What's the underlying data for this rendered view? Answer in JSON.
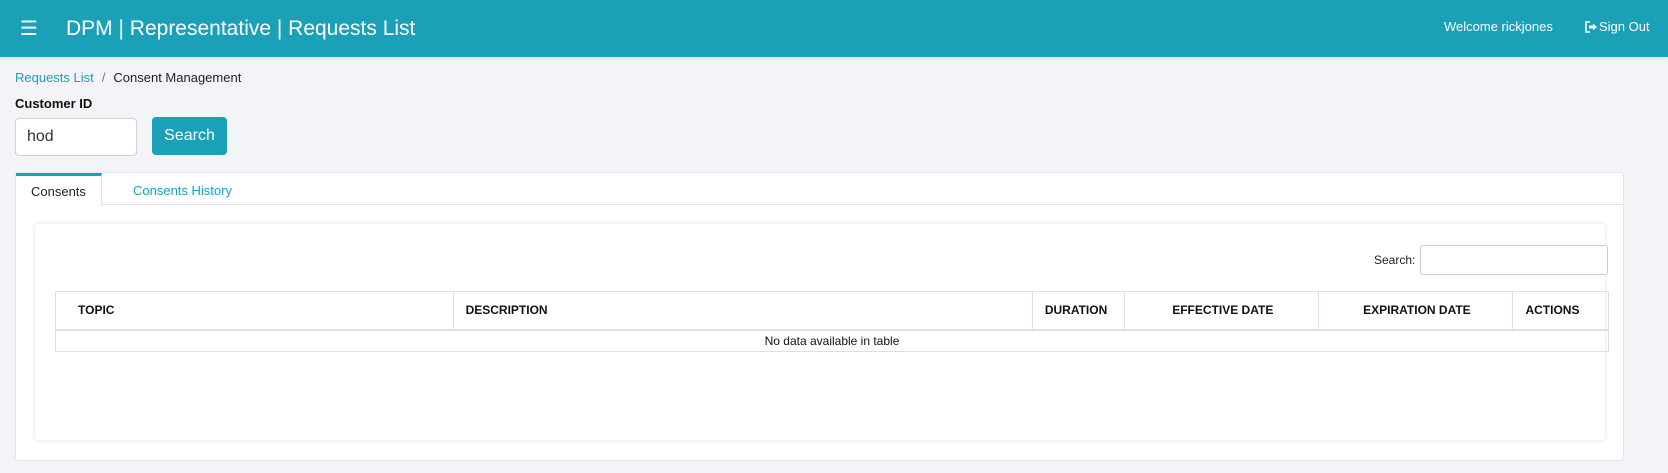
{
  "header": {
    "menu_icon": "hamburger-icon",
    "title": "DPM | Representative | Requests List",
    "welcome": "Welcome rickjones",
    "sign_out": "Sign Out",
    "sign_out_icon": "sign-out-icon",
    "bar_color": "#1aa1b8"
  },
  "breadcrumb": {
    "link": "Requests List",
    "separator": "/",
    "current": "Consent Management"
  },
  "customer": {
    "label": "Customer ID",
    "value": "hod",
    "search_label": "Search"
  },
  "tabs": [
    {
      "label": "Consents",
      "active": true
    },
    {
      "label": "Consents History",
      "active": false
    }
  ],
  "table": {
    "search_label": "Search:",
    "search_value": "",
    "columns": [
      "TOPIC",
      "DESCRIPTION",
      "DURATION",
      "EFFECTIVE DATE",
      "EXPIRATION DATE",
      "ACTIONS"
    ],
    "empty_message": "No data available in table"
  }
}
